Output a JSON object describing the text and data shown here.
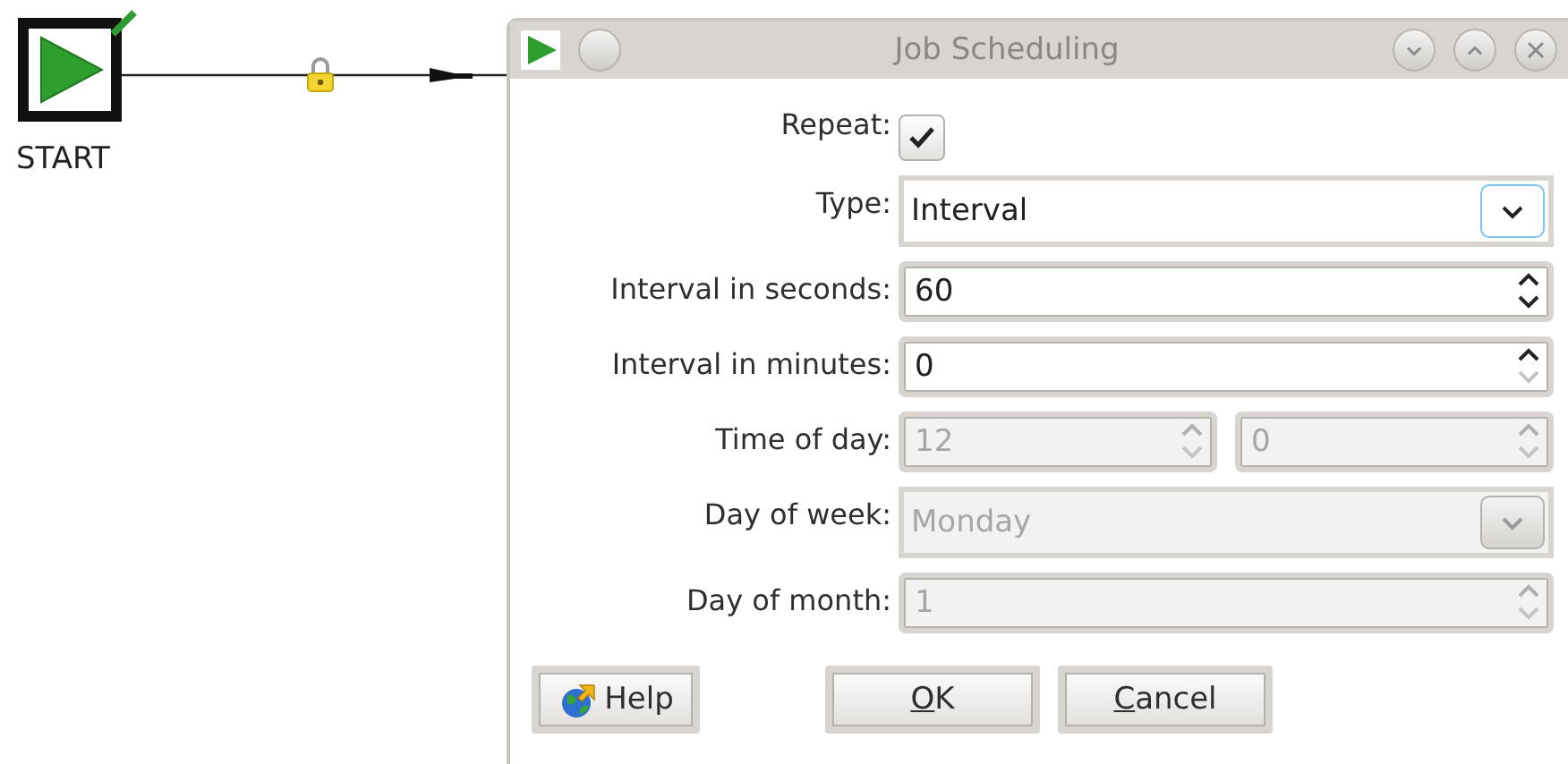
{
  "canvas": {
    "start_node": {
      "label": "START",
      "checked": true
    },
    "hop": {
      "locked": true
    }
  },
  "dialog": {
    "title": "Job Scheduling",
    "rows": [
      {
        "kind": "checkbox",
        "label": "Repeat:",
        "checked": true
      },
      {
        "kind": "combo",
        "label": "Type:",
        "value": "Interval",
        "disabled": false,
        "focused": true
      },
      {
        "kind": "spin",
        "label": "Interval in seconds:",
        "value": "60",
        "disabled": false,
        "down_disabled": false
      },
      {
        "kind": "spin",
        "label": "Interval in minutes:",
        "value": "0",
        "disabled": false,
        "down_disabled": true
      },
      {
        "kind": "spin_pair",
        "label": "Time of day:",
        "values": [
          "12",
          "0"
        ],
        "disabled": true
      },
      {
        "kind": "combo",
        "label": "Day of week:",
        "value": "Monday",
        "disabled": true,
        "focused": false
      },
      {
        "kind": "spin",
        "label": "Day of month:",
        "value": "1",
        "disabled": true,
        "down_disabled": false
      }
    ],
    "buttons": [
      {
        "kind": "help",
        "label": "Help",
        "underline_first": false
      },
      {
        "kind": "ok",
        "label": "OK",
        "underline_first": true
      },
      {
        "kind": "cancel",
        "label": "Cancel",
        "underline_first": true
      }
    ]
  }
}
